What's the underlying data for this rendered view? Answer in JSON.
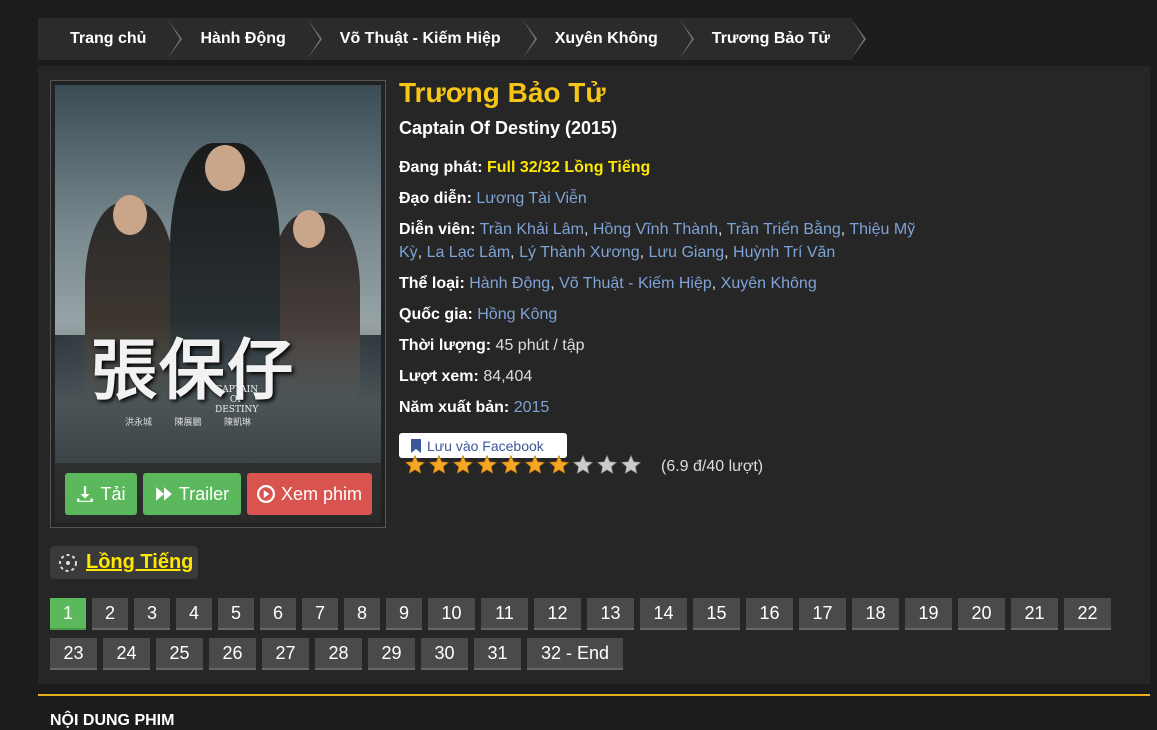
{
  "breadcrumb": [
    "Trang chủ",
    "Hành Động",
    "Võ Thuật - Kiếm Hiệp",
    "Xuyên Không",
    "Trương Bảo Tử"
  ],
  "poster": {
    "calligraphy": "張保仔",
    "caption_line1": "CAPTAIN",
    "caption_line2": "OF",
    "caption_line3": "DESTINY",
    "credits": "洪永城 陳展鵬 陳凱琳"
  },
  "buttons": {
    "download": "Tải",
    "trailer": "Trailer",
    "watch": "Xem phim"
  },
  "movie": {
    "title": "Trương Bảo Tử",
    "subtitle": "Captain Of Destiny (2015)",
    "status_label": "Đang phát:",
    "status_value": "Full 32/32 Lồng Tiếng",
    "director_label": "Đạo diễn:",
    "director": "Lương Tài Viễn",
    "cast_label": "Diễn viên:",
    "cast": [
      "Trần Khải Lâm",
      "Hồng Vĩnh Thành",
      "Trần Triển Bằng",
      "Thiệu Mỹ Kỳ",
      "La Lạc Lâm",
      "Lý Thành Xương",
      "Lưu Giang",
      "Huỳnh Trí Văn"
    ],
    "genre_label": "Thể loại:",
    "genres": [
      "Hành Động",
      "Võ Thuật - Kiếm Hiệp",
      "Xuyên Không"
    ],
    "country_label": "Quốc gia:",
    "country": "Hồng Kông",
    "duration_label": "Thời lượng:",
    "duration": "45 phút / tập",
    "views_label": "Lượt xem:",
    "views": "84,404",
    "year_label": "Năm xuất bản:",
    "year": "2015"
  },
  "facebook_button": "Lưu vào Facebook",
  "rating": {
    "filled_stars": 7,
    "total_stars": 10,
    "text": "(6.9 đ/40 lượt)",
    "star_color": "#f5a623",
    "empty_color": "#cccccc"
  },
  "dub_label": "Lồng Tiếng",
  "episodes": [
    "1",
    "2",
    "3",
    "4",
    "5",
    "6",
    "7",
    "8",
    "9",
    "10",
    "11",
    "12",
    "13",
    "14",
    "15",
    "16",
    "17",
    "18",
    "19",
    "20",
    "21",
    "22",
    "23",
    "24",
    "25",
    "26",
    "27",
    "28",
    "29",
    "30",
    "31",
    "32 - End"
  ],
  "active_episode": "1",
  "section_title": "NỘI DUNG PHIM",
  "colors": {
    "accent_yellow": "#f5c518",
    "link_blue": "#7ea3d6",
    "green": "#5cb85c",
    "red": "#d9534f"
  }
}
